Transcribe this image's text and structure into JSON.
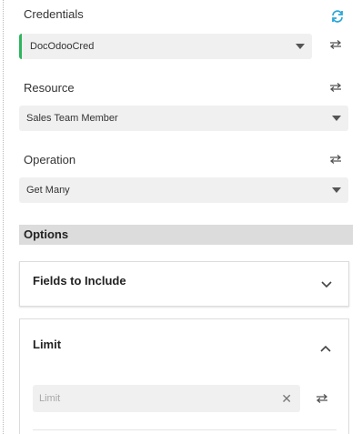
{
  "credentials": {
    "label": "Credentials",
    "selected": "DocOdooCred",
    "accent_color": "#2db55d",
    "refresh_icon": "refresh-icon"
  },
  "resource": {
    "label": "Resource",
    "selected": "Sales Team Member"
  },
  "operation": {
    "label": "Operation",
    "selected": "Get Many"
  },
  "options": {
    "header": "Options",
    "fields_to_include": {
      "title": "Fields to Include",
      "state": "collapsed"
    },
    "limit": {
      "title": "Limit",
      "state": "expanded",
      "input_placeholder": "Limit",
      "input_value": ""
    }
  },
  "icons": {
    "expression_toggle": "swap-arrows-icon",
    "clear": "close-icon",
    "expand": "chevron-down-icon",
    "collapse": "chevron-up-icon"
  }
}
